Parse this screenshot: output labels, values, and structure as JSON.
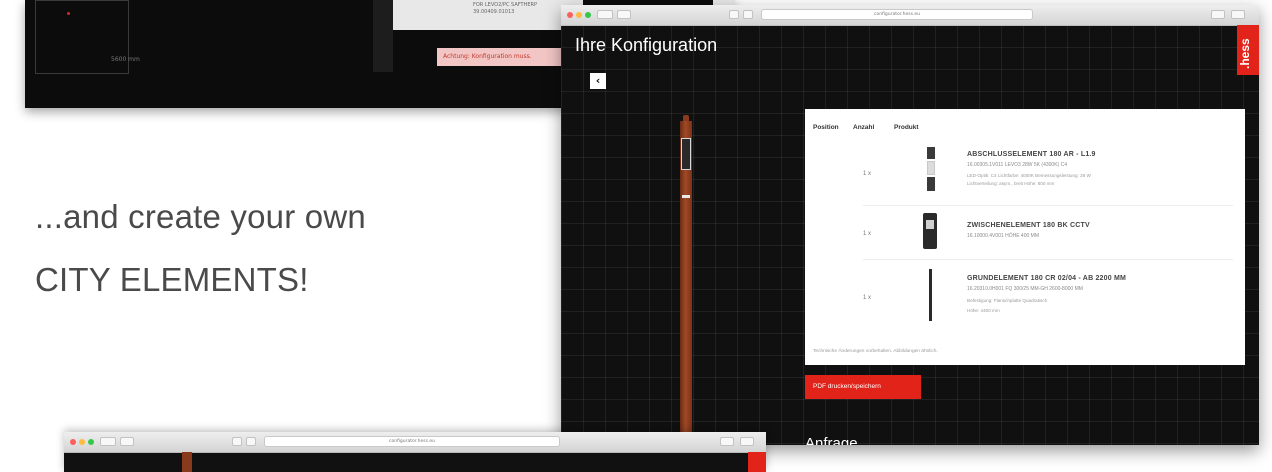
{
  "top_left_window": {
    "size_label": "5600 mm",
    "panel_lines": [
      "FOR LEVO2/PC SAFTHERP",
      "39.00409.01013"
    ],
    "warning": "Achtung: Konfiguration muss."
  },
  "tagline": {
    "line1": "...and create your own",
    "line2": "CITY ELEMENTS!"
  },
  "browser": {
    "address": "configurator.hess.eu",
    "bottom_address": "configurator.hess.eu",
    "traffic_lights": [
      "#fc605c",
      "#fdbc40",
      "#34c84a"
    ]
  },
  "page": {
    "title": "Ihre Konfiguration",
    "brand": ".hess",
    "back_icon": "‹",
    "table_headers": [
      "Position",
      "Anzahl",
      "Produkt"
    ],
    "rows": [
      {
        "qty": "1 x",
        "title": "ABSCHLUSSELEMENT 180 AR - L1.9",
        "code": "16.00305.1V011 LEVO3 28W 5K (4300K) C4",
        "spec1": "LED-Optik: C4    Lichtfarbe: 4000K    Bemessungsleistung: 28 W",
        "spec2": "Lichtverteilung: asym., breit    Höhe: 800 mm"
      },
      {
        "qty": "1 x",
        "title": "ZWISCHENELEMENT 180 BK CCTV",
        "code": "16.10000.4V001 HÖHE 400 MM",
        "spec1": "",
        "spec2": ""
      },
      {
        "qty": "1 x",
        "title": "GRUNDELEMENT 180 CR 02/04 - AB 2200 MM",
        "code": "16.20310.0H001 FQ 300/25 MM-GH 2600-8000 MM",
        "spec1": "Befestigung: Flanschplatte Quadratisch",
        "spec2": "Höhe: 4400 mm"
      }
    ],
    "footnote": "Technische Änderungen vorbehalten. Abbildungen ähnlich.",
    "pdf_button": "PDF drucken/speichern",
    "request_heading": "Anfrage"
  },
  "colors": {
    "brand_red": "#e2231a",
    "pole": "#a04a26",
    "window_bg": "#101010"
  }
}
